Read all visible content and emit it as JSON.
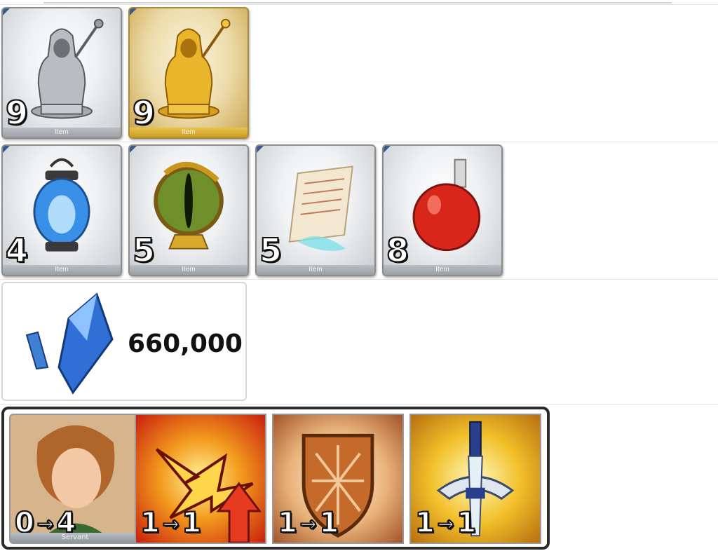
{
  "materials": {
    "row1": [
      {
        "icon": "silver-statue-icon",
        "count": "9",
        "label": "Item",
        "rarity": "silver"
      },
      {
        "icon": "gold-statue-icon",
        "count": "9",
        "label": "Item",
        "rarity": "gold"
      }
    ],
    "row2": [
      {
        "icon": "blue-lantern-icon",
        "count": "4",
        "label": "Item"
      },
      {
        "icon": "serpent-eye-icon",
        "count": "5",
        "label": "Item"
      },
      {
        "icon": "ghost-paper-icon",
        "count": "5",
        "label": "Item"
      },
      {
        "icon": "red-potion-flask-icon",
        "count": "8",
        "label": "Item"
      }
    ]
  },
  "qp": {
    "icon": "blue-crystal-icon",
    "amount": "660,000"
  },
  "levels": [
    {
      "icon": "servant-portrait-icon",
      "from": "0",
      "to": "4",
      "label": "Servant"
    },
    {
      "icon": "attack-up-skill-icon",
      "from": "1",
      "to": "1"
    },
    {
      "icon": "shield-skill-icon",
      "from": "1",
      "to": "1"
    },
    {
      "icon": "sword-skill-icon",
      "from": "1",
      "to": "1"
    }
  ],
  "arrow": "→",
  "colors": {
    "gold": "#d9a81e",
    "silver": "#c8ccd0",
    "frame": "#2a2a2a"
  }
}
